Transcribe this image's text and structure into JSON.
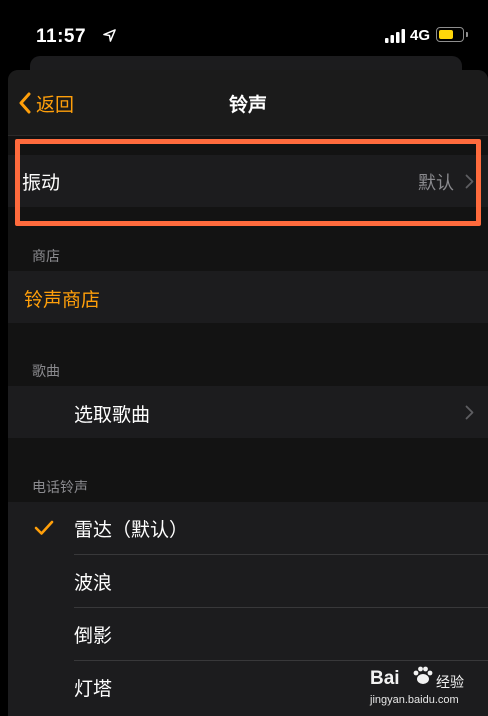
{
  "status_bar": {
    "time": "11:57",
    "network": "4G",
    "battery_level": 0.65,
    "battery_color": "#ffd60a"
  },
  "nav": {
    "back_label": "返回",
    "title": "铃声",
    "accent_color": "#ff9f0a"
  },
  "vibration": {
    "label": "振动",
    "value": "默认"
  },
  "store_section": {
    "header": "商店",
    "link_label": "铃声商店"
  },
  "songs_section": {
    "header": "歌曲",
    "pick_label": "选取歌曲"
  },
  "ringtones_section": {
    "header": "电话铃声",
    "items": [
      {
        "label": "雷达（默认）",
        "selected": true
      },
      {
        "label": "波浪",
        "selected": false
      },
      {
        "label": "倒影",
        "selected": false
      },
      {
        "label": "灯塔",
        "selected": false
      }
    ]
  },
  "watermark": {
    "brand": "Bai",
    "brand_suffix": "经验",
    "url": "jingyan.baidu.com"
  },
  "icons": {
    "location": "location-arrow-icon",
    "signal": "cellular-signal-icon",
    "battery": "battery-icon",
    "back": "chevron-left-icon",
    "disclosure": "chevron-right-icon",
    "checkmark": "checkmark-icon"
  },
  "highlight_color": "#ff6b3d"
}
